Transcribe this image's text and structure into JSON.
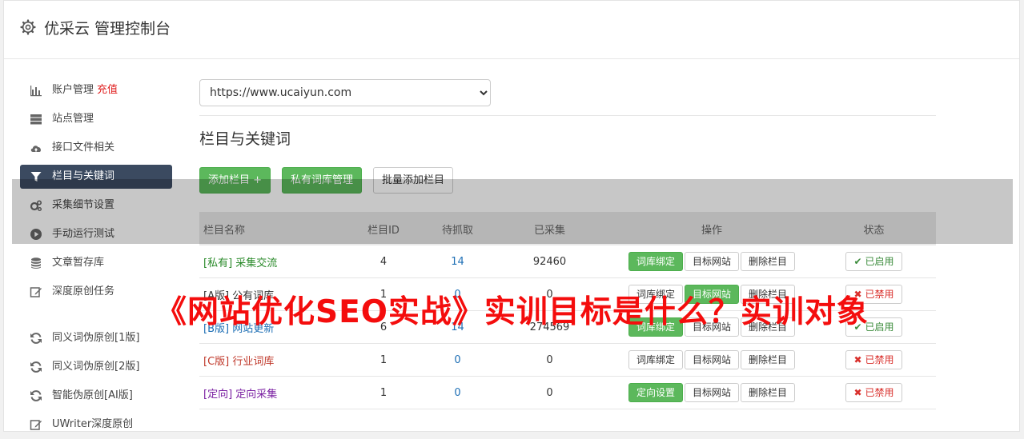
{
  "header": {
    "title": "优采云 管理控制台"
  },
  "sidebar": {
    "items": [
      {
        "label": "账户管理",
        "extra": "充值",
        "icon": "bar-chart-icon"
      },
      {
        "label": "站点管理",
        "icon": "server-icon"
      },
      {
        "label": "接口文件相关",
        "icon": "cloud-upload-icon"
      },
      {
        "label": "栏目与关键词",
        "icon": "filter-icon",
        "active": true
      },
      {
        "label": "采集细节设置",
        "icon": "gears-icon"
      },
      {
        "label": "手动运行测试",
        "icon": "play-circle-icon"
      },
      {
        "label": "文章暂存库",
        "icon": "database-icon"
      },
      {
        "label": "深度原创任务",
        "icon": "edit-icon"
      }
    ],
    "items2": [
      {
        "label": "同义词伪原创[1版]",
        "icon": "refresh-icon"
      },
      {
        "label": "同义词伪原创[2版]",
        "icon": "refresh-icon"
      },
      {
        "label": "智能伪原创[AI版]",
        "icon": "refresh-icon"
      },
      {
        "label": "UWriter深度原创",
        "icon": "edit-icon"
      }
    ]
  },
  "main": {
    "site_select": "https://www.ucaiyun.com",
    "section_title": "栏目与关键词",
    "buttons": {
      "add_column": "添加栏目 +",
      "private_lib": "私有词库管理",
      "batch_add": "批量添加栏目"
    },
    "table": {
      "headers": [
        "栏目名称",
        "栏目ID",
        "待抓取",
        "已采集",
        "操作",
        "状态"
      ],
      "rows": [
        {
          "name": "[私有] 采集交流",
          "name_color": "#2a8a2a",
          "id": "4",
          "pending": "14",
          "collected": "92460",
          "op1": "词库绑定",
          "op1_on": true,
          "op2": "目标网站",
          "op2_on": false,
          "op3": "删除栏目",
          "status": "已启用",
          "status_ok": true
        },
        {
          "name": "[A版] 公有词库",
          "name_color": "#333333",
          "id": "1",
          "pending": "0",
          "collected": "0",
          "op1": "词库绑定",
          "op1_on": false,
          "op2": "目标网站",
          "op2_on": true,
          "op3": "删除栏目",
          "status": "已禁用",
          "status_ok": false
        },
        {
          "name": "[B版] 网站更新",
          "name_color": "#1e6fb5",
          "id": "6",
          "pending": "14",
          "collected": "274569",
          "op1": "词库绑定",
          "op1_on": true,
          "op2": "目标网站",
          "op2_on": false,
          "op3": "删除栏目",
          "status": "已启用",
          "status_ok": true
        },
        {
          "name": "[C版] 行业词库",
          "name_color": "#c0392b",
          "id": "1",
          "pending": "0",
          "collected": "0",
          "op1": "词库绑定",
          "op1_on": false,
          "op2": "目标网站",
          "op2_on": false,
          "op3": "删除栏目",
          "status": "已禁用",
          "status_ok": false
        },
        {
          "name": "[定向] 定向采集",
          "name_color": "#7a1fa2",
          "id": "1",
          "pending": "0",
          "collected": "0",
          "op1": "定向设置",
          "op1_on": true,
          "op2": "目标网站",
          "op2_on": false,
          "op3": "删除栏目",
          "status": "已禁用",
          "status_ok": false
        }
      ]
    }
  },
  "banner": {
    "text": "《网站优化SEO实战》实训目标是什么？实训对象"
  },
  "colors": {
    "green": "#5cb85c",
    "sidebar_active": "#3b4a60",
    "banner_red": "#f40d0d"
  }
}
